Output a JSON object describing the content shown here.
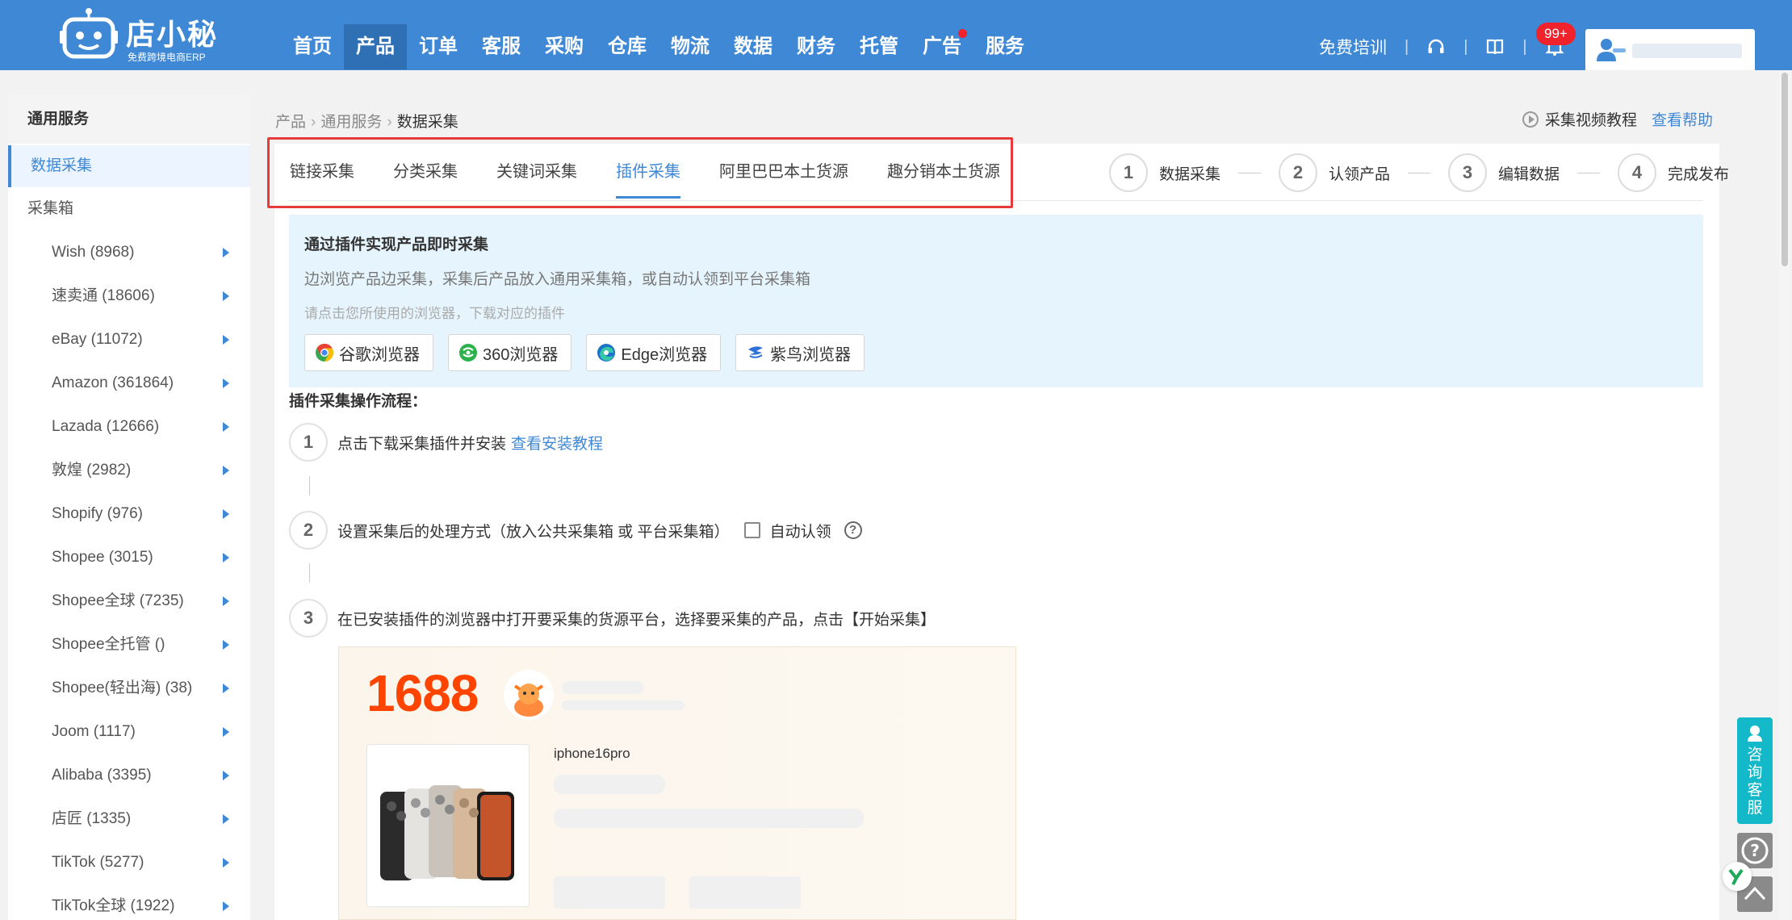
{
  "brand": {
    "title": "店小秘",
    "subtitle": "免费跨境电商ERP"
  },
  "nav": {
    "items": [
      {
        "label": "首页",
        "active": false
      },
      {
        "label": "产品",
        "active": true
      },
      {
        "label": "订单",
        "active": false
      },
      {
        "label": "客服",
        "active": false
      },
      {
        "label": "采购",
        "active": false
      },
      {
        "label": "仓库",
        "active": false
      },
      {
        "label": "物流",
        "active": false
      },
      {
        "label": "数据",
        "active": false
      },
      {
        "label": "财务",
        "active": false
      },
      {
        "label": "托管",
        "active": false
      },
      {
        "label": "广告",
        "active": false,
        "dot": true
      },
      {
        "label": "服务",
        "active": false
      }
    ],
    "training": "免费培训",
    "notification_count": "99+"
  },
  "sidebar": {
    "header": "通用服务",
    "active": "数据采集",
    "group": "采集箱",
    "items": [
      "Wish (8968)",
      "速卖通 (18606)",
      "eBay (11072)",
      "Amazon (361864)",
      "Lazada (12666)",
      "敦煌 (2982)",
      "Shopify (976)",
      "Shopee (3015)",
      "Shopee全球 (7235)",
      "Shopee全托管 ()",
      "Shopee(轻出海) (38)",
      "Joom (1117)",
      "Alibaba (3395)",
      "店匠 (1335)",
      "TikTok (5277)",
      "TikTok全球 (1922)"
    ]
  },
  "breadcrumb": {
    "root": "产品",
    "mid": "通用服务",
    "current": "数据采集"
  },
  "help": {
    "video": "采集视频教程",
    "help": "查看帮助"
  },
  "tabs": [
    "链接采集",
    "分类采集",
    "关键词采集",
    "插件采集",
    "阿里巴巴本土货源",
    "趣分销本土货源"
  ],
  "active_tab": "插件采集",
  "steps": [
    {
      "num": "1",
      "label": "数据采集"
    },
    {
      "num": "2",
      "label": "认领产品"
    },
    {
      "num": "3",
      "label": "编辑数据"
    },
    {
      "num": "4",
      "label": "完成发布"
    }
  ],
  "info": {
    "title": "通过插件实现产品即时采集",
    "desc": "边浏览产品边采集，采集后产品放入通用采集箱，或自动认领到平台采集箱",
    "hint": "请点击您所使用的浏览器，下载对应的插件",
    "browsers": [
      "谷歌浏览器",
      "360浏览器",
      "Edge浏览器",
      "紫鸟浏览器"
    ]
  },
  "flow": {
    "title": "插件采集操作流程：",
    "step1": {
      "num": "1",
      "text": "点击下载采集插件并安装",
      "link": "查看安装教程"
    },
    "step2": {
      "num": "2",
      "text": "设置采集后的处理方式（放入公共采集箱 或 平台采集箱）",
      "checkbox": "自动认领"
    },
    "step3": {
      "num": "3",
      "text": "在已安装插件的浏览器中打开要采集的货源平台，选择要采集的产品，点击【开始采集】"
    }
  },
  "demo": {
    "logo": "1688",
    "product": "iphone16pro"
  },
  "float": {
    "service": "咨询客服"
  }
}
